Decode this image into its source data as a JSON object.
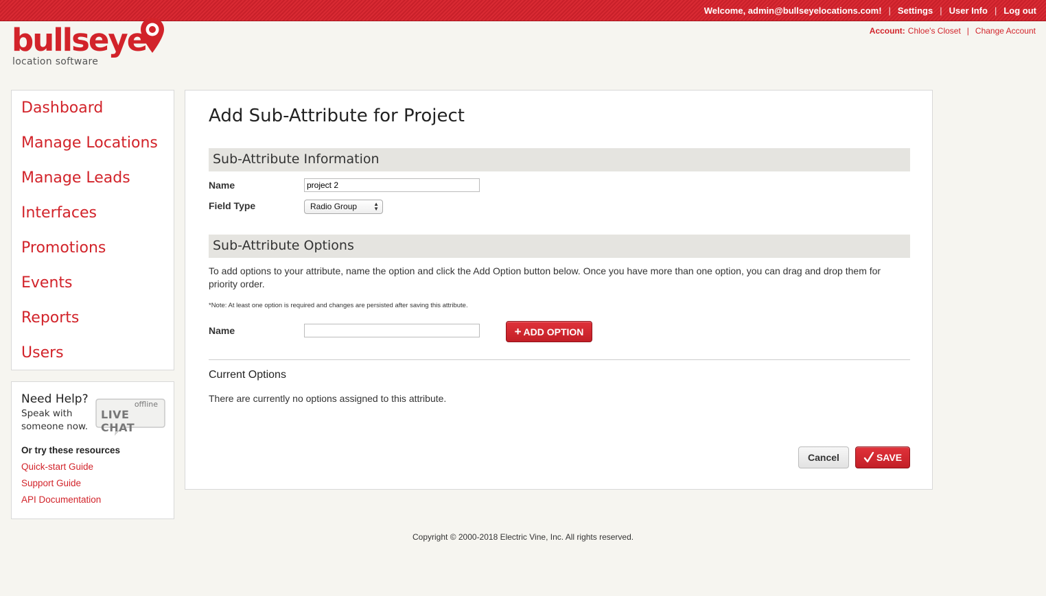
{
  "header": {
    "welcome": "Welcome, admin@bullseyelocations.com!",
    "settings": "Settings",
    "user_info": "User Info",
    "logout": "Log out",
    "account_label": "Account:",
    "account_name": "Chloe's Closet",
    "change_account": "Change Account",
    "separator": "|"
  },
  "logo": {
    "word": "bullseye",
    "tagline": "location software",
    "pin_icon": "map-pin-icon",
    "brand_color": "#d2232a"
  },
  "sidebar": {
    "items": [
      {
        "label": "Dashboard"
      },
      {
        "label": "Manage Locations"
      },
      {
        "label": "Manage Leads"
      },
      {
        "label": "Interfaces"
      },
      {
        "label": "Promotions"
      },
      {
        "label": "Events"
      },
      {
        "label": "Reports"
      },
      {
        "label": "Users"
      }
    ]
  },
  "help": {
    "title": "Need Help?",
    "subtitle": "Speak with someone now.",
    "chat_status": "offline",
    "chat_label": "LIVE CHAT",
    "resources_title": "Or try these resources",
    "links": [
      "Quick-start Guide",
      "Support Guide",
      "API Documentation"
    ]
  },
  "main": {
    "page_title": "Add Sub-Attribute for Project",
    "info_section": "Sub-Attribute Information",
    "name_label": "Name",
    "name_value": "project 2",
    "field_type_label": "Field Type",
    "field_type_value": "Radio Group",
    "options_section": "Sub-Attribute Options",
    "description": "To add options to your attribute, name the option and click the Add Option button below. Once you have more than one option, you can drag and drop them for priority order.",
    "note": "*Note: At least one option is required and changes are persisted after saving this attribute.",
    "option_name_label": "Name",
    "option_name_value": "",
    "add_option_button": "ADD OPTION",
    "current_options_title": "Current Options",
    "no_options_text": "There are currently no options assigned to this attribute.",
    "cancel_button": "Cancel",
    "save_button": "SAVE"
  },
  "footer": {
    "copyright": "Copyright © 2000-2018 Electric Vine, Inc. All rights reserved."
  }
}
